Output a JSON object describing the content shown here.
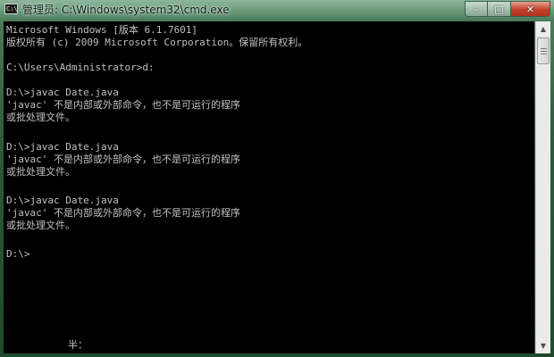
{
  "window": {
    "title": "管理员: C:\\Windows\\system32\\cmd.exe",
    "icon": "cmd-icon",
    "icon_text": "C:\\"
  },
  "controls": {
    "minimize": "‒",
    "maximize": "□",
    "close": "✕"
  },
  "console": {
    "lines": [
      "Microsoft Windows [版本 6.1.7601]",
      "版权所有 (c) 2009 Microsoft Corporation。保留所有权利。",
      "",
      "C:\\Users\\Administrator>d:",
      "",
      "D:\\>javac Date.java",
      "'javac' 不是内部或外部命令，也不是可运行的程序",
      "或批处理文件。",
      "",
      "D:\\>javac Date.java",
      "'javac' 不是内部或外部命令，也不是可运行的程序",
      "或批处理文件。",
      "",
      "D:\\>javac Date.java",
      "'javac' 不是内部或外部命令，也不是可运行的程序",
      "或批处理文件。",
      "",
      "D:\\>"
    ],
    "ime_status": "半："
  },
  "colors": {
    "console_background": "#000000",
    "console_text": "#c0c0c0",
    "close_button": "#c3412b"
  }
}
